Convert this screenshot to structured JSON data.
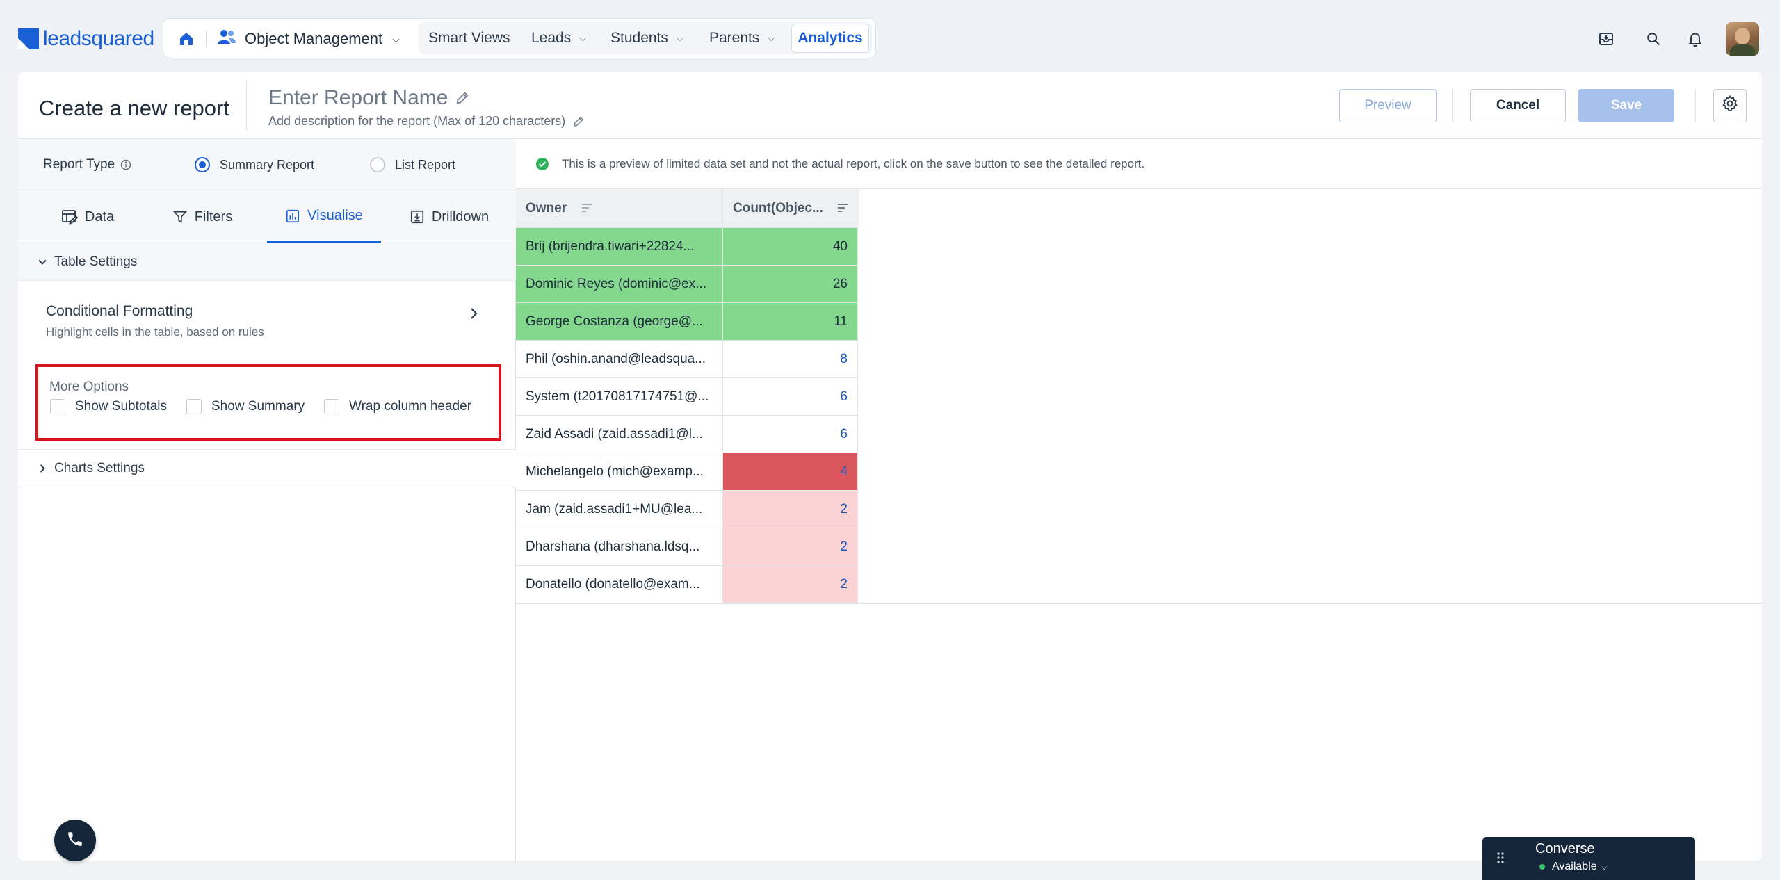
{
  "brand": {
    "logo_text": "leadsquared",
    "accent": "#1a5fd6"
  },
  "nav": {
    "home_icon": "home-icon",
    "object_management": "Object Management",
    "items": [
      {
        "label": "Smart Views",
        "has_menu": false
      },
      {
        "label": "Leads",
        "has_menu": true
      },
      {
        "label": "Students",
        "has_menu": true
      },
      {
        "label": "Parents",
        "has_menu": true
      }
    ],
    "active_item": "Analytics"
  },
  "header": {
    "title": "Create a new report",
    "report_name_placeholder": "Enter Report Name",
    "description_placeholder": "Add description for the report (Max of 120 characters)",
    "preview_label": "Preview",
    "cancel_label": "Cancel",
    "save_label": "Save"
  },
  "report_type": {
    "label": "Report Type",
    "options": [
      {
        "label": "Summary Report",
        "selected": true
      },
      {
        "label": "List Report",
        "selected": false
      }
    ]
  },
  "tabs": [
    {
      "label": "Data",
      "icon": "data-icon",
      "active": false
    },
    {
      "label": "Filters",
      "icon": "filter-icon",
      "active": false
    },
    {
      "label": "Visualise",
      "icon": "bar-chart-icon",
      "active": true
    },
    {
      "label": "Drilldown",
      "icon": "drilldown-icon",
      "active": false
    }
  ],
  "table_settings": {
    "label": "Table Settings",
    "conditional_formatting": {
      "title": "Conditional Formatting",
      "subtitle": "Highlight cells in the table, based on rules"
    },
    "more_options": {
      "title": "More Options",
      "checkboxes": [
        {
          "label": "Show Subtotals",
          "checked": false
        },
        {
          "label": "Show Summary",
          "checked": false
        },
        {
          "label": "Wrap column header",
          "checked": false
        }
      ]
    }
  },
  "charts_settings": {
    "label": "Charts Settings"
  },
  "notice": "This is a preview of limited data set and not the actual report, click on the save button to see the detailed report.",
  "table": {
    "columns": [
      "Owner",
      "Count(Objec..."
    ],
    "rows": [
      {
        "owner": "Brij (brijendra.tiwari+22824...",
        "count": "40",
        "bg": "#84d88e",
        "fg": "#1f2d3d"
      },
      {
        "owner": "Dominic Reyes (dominic@ex...",
        "count": "26",
        "bg": "#84d88e",
        "fg": "#1f2d3d"
      },
      {
        "owner": "George Costanza (george@...",
        "count": "11",
        "bg": "#84d88e",
        "fg": "#1f2d3d"
      },
      {
        "owner": "Phil (oshin.anand@leadsqua...",
        "count": "8",
        "bg": "#ffffff",
        "fg": "#1a56b8"
      },
      {
        "owner": "System (t20170817174751@...",
        "count": "6",
        "bg": "#ffffff",
        "fg": "#1a56b8"
      },
      {
        "owner": "Zaid Assadi (zaid.assadi1@l...",
        "count": "6",
        "bg": "#ffffff",
        "fg": "#1a56b8"
      },
      {
        "owner": "Michelangelo (mich@examp...",
        "count": "4",
        "bg": "#d9575a",
        "fg": "#1a56b8"
      },
      {
        "owner": "Jam (zaid.assadi1+MU@lea...",
        "count": "2",
        "bg": "#fbd3d4",
        "fg": "#1a56b8"
      },
      {
        "owner": "Dharshana (dharshana.ldsq...",
        "count": "2",
        "bg": "#fbd3d4",
        "fg": "#1a56b8"
      },
      {
        "owner": "Donatello (donatello@exam...",
        "count": "2",
        "bg": "#fbd3d4",
        "fg": "#1a56b8"
      }
    ]
  },
  "converse": {
    "title": "Converse",
    "status": "Available"
  }
}
